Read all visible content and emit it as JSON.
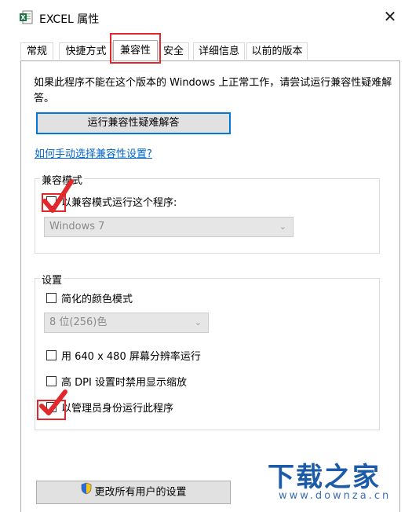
{
  "window": {
    "title": "EXCEL 属性",
    "close_glyph": "✕",
    "icon": "excel-file-icon"
  },
  "tabs": [
    {
      "label": "常规",
      "active": false
    },
    {
      "label": "快捷方式",
      "active": false
    },
    {
      "label": "兼容性",
      "active": true
    },
    {
      "label": "安全",
      "active": false
    },
    {
      "label": "详细信息",
      "active": false
    },
    {
      "label": "以前的版本",
      "active": false
    }
  ],
  "compat": {
    "intro": "如果此程序不能在这个版本的 Windows 上正常工作，请尝试运行兼容性疑难解答。",
    "troubleshoot_button": "运行兼容性疑难解答",
    "manual_link": "如何手动选择兼容性设置?",
    "mode_group_title": "兼容模式",
    "mode_checkbox_label": "以兼容模式运行这个程序:",
    "mode_select_value": "Windows 7",
    "settings_group_title": "设置",
    "reduced_color_label": "简化的颜色模式",
    "color_select_value": "8 位(256)色",
    "res_640_label": "用 640 x 480 屏幕分辨率运行",
    "high_dpi_label": "高 DPI 设置时禁用显示缩放",
    "run_as_admin_label": "以管理员身份运行此程序",
    "change_all_users_button": "更改所有用户的设置",
    "shield_icon": "uac-shield-icon"
  },
  "watermark": {
    "main": "下载之家",
    "sub": "www.downza.cn"
  },
  "colors": {
    "annotation_red": "#e0282d",
    "link_blue": "#0066cc",
    "focus_blue": "#0078d7",
    "watermark_blue": "#1b5ba8"
  }
}
